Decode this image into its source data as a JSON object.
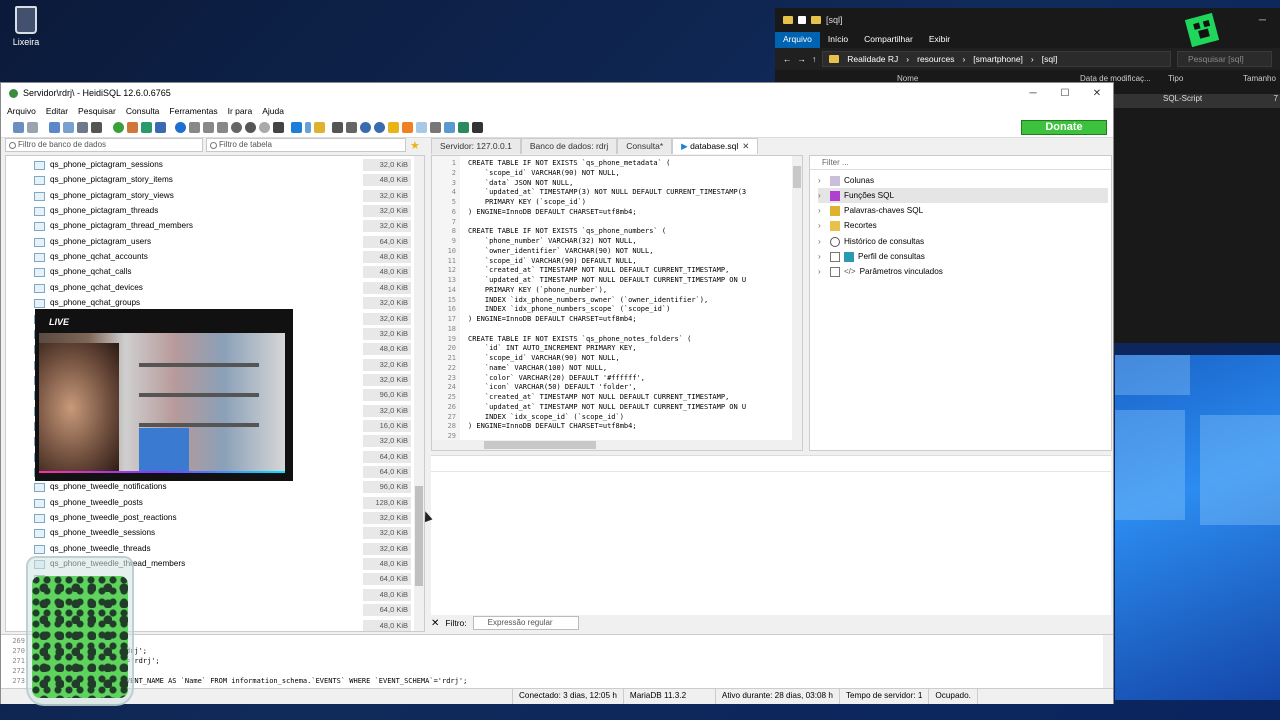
{
  "desktop": {
    "recycle_bin_label": "Lixeira"
  },
  "explorer": {
    "path_title": "[sql]",
    "ribbon": [
      "Arquivo",
      "Início",
      "Compartilhar",
      "Exibir"
    ],
    "breadcrumb": [
      "Realidade RJ",
      "resources",
      "[smartphone]",
      "[sql]"
    ],
    "search_placeholder": "Pesquisar [sql]",
    "columns": [
      "Nome",
      "Data de modificaç...",
      "Tipo",
      "Tamanho"
    ],
    "file_row": {
      "date": "26 21:02",
      "type": "SQL-Script",
      "size": "7"
    }
  },
  "heidi": {
    "title": "Servidor\\rdrj\\ - HeidiSQL 12.6.0.6765",
    "menu": [
      "Arquivo",
      "Editar",
      "Pesquisar",
      "Consulta",
      "Ferramentas",
      "Ir para",
      "Ajuda"
    ],
    "donate_label": "Donate",
    "db_filter_placeholder": "Filtro de banco de dados",
    "table_filter_placeholder": "Filtro de tabela",
    "tabs": [
      "Servidor: 127.0.0.1",
      "Banco de dados: rdrj",
      "Consulta*",
      "database.sql"
    ],
    "tree": [
      {
        "name": "qs_phone_pictagram_sessions",
        "size": "32,0 KiB"
      },
      {
        "name": "qs_phone_pictagram_story_items",
        "size": "48,0 KiB"
      },
      {
        "name": "qs_phone_pictagram_story_views",
        "size": "32,0 KiB"
      },
      {
        "name": "qs_phone_pictagram_threads",
        "size": "32,0 KiB"
      },
      {
        "name": "qs_phone_pictagram_thread_members",
        "size": "32,0 KiB"
      },
      {
        "name": "qs_phone_pictagram_users",
        "size": "64,0 KiB"
      },
      {
        "name": "qs_phone_qchat_accounts",
        "size": "48,0 KiB"
      },
      {
        "name": "qs_phone_qchat_calls",
        "size": "48,0 KiB"
      },
      {
        "name": "qs_phone_qchat_devices",
        "size": "48,0 KiB"
      },
      {
        "name": "qs_phone_qchat_groups",
        "size": "32,0 KiB"
      },
      {
        "name": "",
        "size": "32,0 KiB"
      },
      {
        "name": "",
        "size": "32,0 KiB"
      },
      {
        "name": "",
        "size": "48,0 KiB"
      },
      {
        "name": "",
        "size": "32,0 KiB"
      },
      {
        "name": "",
        "size": "32,0 KiB"
      },
      {
        "name": "",
        "size": "96,0 KiB"
      },
      {
        "name": "",
        "size": "32,0 KiB"
      },
      {
        "name": "",
        "size": "16,0 KiB"
      },
      {
        "name": "",
        "size": "32,0 KiB"
      },
      {
        "name": "",
        "size": "64,0 KiB"
      },
      {
        "name": "",
        "size": "64,0 KiB"
      },
      {
        "name": "qs_phone_tweedle_notifications",
        "size": "96,0 KiB"
      },
      {
        "name": "qs_phone_tweedle_posts",
        "size": "128,0 KiB"
      },
      {
        "name": "qs_phone_tweedle_post_reactions",
        "size": "32,0 KiB"
      },
      {
        "name": "qs_phone_tweedle_sessions",
        "size": "32,0 KiB"
      },
      {
        "name": "qs_phone_tweedle_threads",
        "size": "32,0 KiB"
      },
      {
        "name": "qs_phone_tweedle_thread_members",
        "size": "48,0 KiB"
      },
      {
        "name": "",
        "size": "64,0 KiB"
      },
      {
        "name": "",
        "size": "48,0 KiB"
      },
      {
        "name": "",
        "size": "64,0 KiB"
      },
      {
        "name": "",
        "size": "48,0 KiB"
      }
    ],
    "editor_lines": [
      {
        "n": "1",
        "t": "CREATE TABLE IF NOT EXISTS `qs_phone_metadata` ("
      },
      {
        "n": "2",
        "t": "    `scope_id` VARCHAR(90) NOT NULL,"
      },
      {
        "n": "3",
        "t": "    `data` JSON NOT NULL,"
      },
      {
        "n": "4",
        "t": "    `updated_at` TIMESTAMP(3) NOT NULL DEFAULT CURRENT_TIMESTAMP(3"
      },
      {
        "n": "5",
        "t": "    PRIMARY KEY (`scope_id`)"
      },
      {
        "n": "6",
        "t": ") ENGINE=InnoDB DEFAULT CHARSET=utf8mb4;"
      },
      {
        "n": "7",
        "t": ""
      },
      {
        "n": "8",
        "t": "CREATE TABLE IF NOT EXISTS `qs_phone_numbers` ("
      },
      {
        "n": "9",
        "t": "    `phone_number` VARCHAR(32) NOT NULL,"
      },
      {
        "n": "10",
        "t": "    `owner_identifier` VARCHAR(90) NOT NULL,"
      },
      {
        "n": "11",
        "t": "    `scope_id` VARCHAR(90) DEFAULT NULL,"
      },
      {
        "n": "12",
        "t": "    `created_at` TIMESTAMP NOT NULL DEFAULT CURRENT_TIMESTAMP,"
      },
      {
        "n": "13",
        "t": "    `updated_at` TIMESTAMP NOT NULL DEFAULT CURRENT_TIMESTAMP ON U"
      },
      {
        "n": "14",
        "t": "    PRIMARY KEY (`phone_number`),"
      },
      {
        "n": "15",
        "t": "    INDEX `idx_phone_numbers_owner` (`owner_identifier`),"
      },
      {
        "n": "16",
        "t": "    INDEX `idx_phone_numbers_scope` (`scope_id`)"
      },
      {
        "n": "17",
        "t": ") ENGINE=InnoDB DEFAULT CHARSET=utf8mb4;"
      },
      {
        "n": "18",
        "t": ""
      },
      {
        "n": "19",
        "t": "CREATE TABLE IF NOT EXISTS `qs_phone_notes_folders` ("
      },
      {
        "n": "20",
        "t": "    `id` INT AUTO_INCREMENT PRIMARY KEY,"
      },
      {
        "n": "21",
        "t": "    `scope_id` VARCHAR(90) NOT NULL,"
      },
      {
        "n": "22",
        "t": "    `name` VARCHAR(100) NOT NULL,"
      },
      {
        "n": "23",
        "t": "    `color` VARCHAR(20) DEFAULT '#ffffff',"
      },
      {
        "n": "24",
        "t": "    `icon` VARCHAR(50) DEFAULT 'folder',"
      },
      {
        "n": "25",
        "t": "    `created_at` TIMESTAMP NOT NULL DEFAULT CURRENT_TIMESTAMP,"
      },
      {
        "n": "26",
        "t": "    `updated_at` TIMESTAMP NOT NULL DEFAULT CURRENT_TIMESTAMP ON U"
      },
      {
        "n": "27",
        "t": "    INDEX `idx_scope_id` (`scope_id`)"
      },
      {
        "n": "28",
        "t": ") ENGINE=InnoDB DEFAULT CHARSET=utf8mb4;"
      },
      {
        "n": "29",
        "t": ""
      }
    ],
    "helpers_filter_placeholder": "Filter ...",
    "helpers": [
      "Colunas",
      "Funções SQL",
      "Palavras-chaves SQL",
      "Recortes",
      "Histórico de consultas",
      "Perfil de consultas",
      "Parâmetros vinculados"
    ],
    "filter_label": "Filtro:",
    "filter_placeholder": "Expressão regular",
    "log_lines": [
      {
        "n": "269",
        "t": "          OM `rdrj`;"
      },
      {
        "n": "270",
        "t": "          WHERE `Db`='rdrj';"
      },
      {
        "n": "271",
        "t": "          US WHERE `Db`='rdrj';"
      },
      {
        "n": "272",
        "t": "          rdrj`;"
      },
      {
        "n": "273",
        "t": "          MA AS `Db`, EVENT_NAME AS `Name` FROM information_schema.`EVENTS` WHERE `EVENT_SCHEMA`='rdrj';"
      }
    ],
    "status": [
      "Conectado: 3 dias, 12:05 h",
      "MariaDB 11.3.2",
      "Ativo durante: 28 dias, 03:08 h",
      "Tempo de servidor: 1",
      "Ocupado."
    ]
  },
  "overlay": {
    "live_label": "LIVE"
  }
}
